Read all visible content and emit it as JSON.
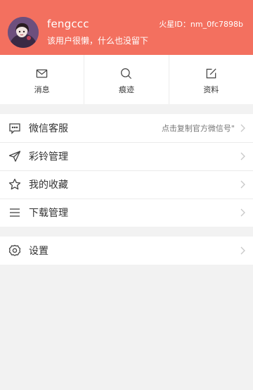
{
  "profile": {
    "username": "fengccc",
    "signature": "该用户很懒，什么也没留下",
    "user_id": "火星ID：nm_0fc7898b"
  },
  "quick_actions": [
    {
      "label": "消息",
      "icon": "envelope-icon"
    },
    {
      "label": "痕迹",
      "icon": "search-icon"
    },
    {
      "label": "资料",
      "icon": "edit-icon"
    }
  ],
  "menu": {
    "items": [
      {
        "label": "微信客服",
        "hint": "点击复制官方微信号\"",
        "icon": "chat-bubble-icon"
      },
      {
        "label": "彩铃管理",
        "icon": "paper-plane-icon"
      },
      {
        "label": "我的收藏",
        "icon": "star-icon"
      },
      {
        "label": "下载管理",
        "icon": "menu-lines-icon"
      }
    ],
    "settings": {
      "label": "设置",
      "icon": "gear-icon"
    }
  },
  "colors": {
    "header_bg": "#f3705f",
    "page_bg": "#f2f2f2"
  }
}
